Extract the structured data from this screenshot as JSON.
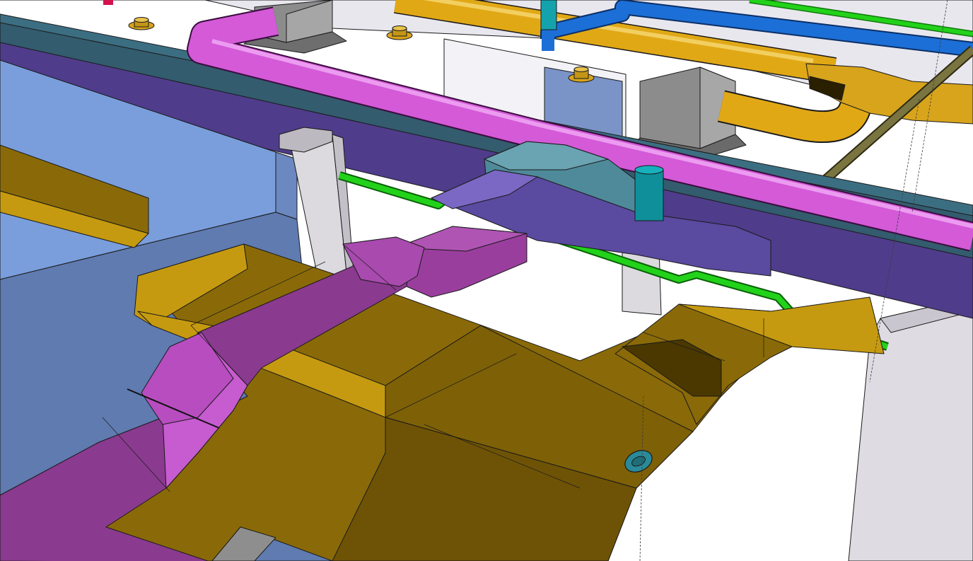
{
  "scene": {
    "kind": "3d-mep-model-render",
    "colors": {
      "wall": "#e6e4ea",
      "wall_shade": "#cfccd6",
      "column": "#dcdadf",
      "ceiling_panel": "#7a9edc",
      "ceiling_panel_dark": "#5f7bb0",
      "beam_teal": "#335c6e",
      "beam_purple": "#4f3c8a",
      "duct_yellow_top": "#8a6a08",
      "duct_yellow_face": "#c69a10",
      "duct_yellow_dark": "#6e5306",
      "duct_magenta_top": "#8a3a8f",
      "duct_magenta_face": "#c75bd0",
      "duct_violet": "#5a4aa0",
      "duct_teal": "#4f8a9a",
      "pipe_magenta": "#d45ad8",
      "pipe_orange": "#e1a816",
      "pipe_blue": "#1c6fd6",
      "pipe_green": "#22d21a",
      "pipe_olive": "#6f6a3a",
      "pipe_cyan": "#0f8f9a",
      "unit_gray": "#8c8c8c",
      "fitting_gold": "#d7a41c"
    },
    "icons": {
      "diffuser": "cylinder-cap",
      "access_panel": "oval-hatch"
    }
  }
}
